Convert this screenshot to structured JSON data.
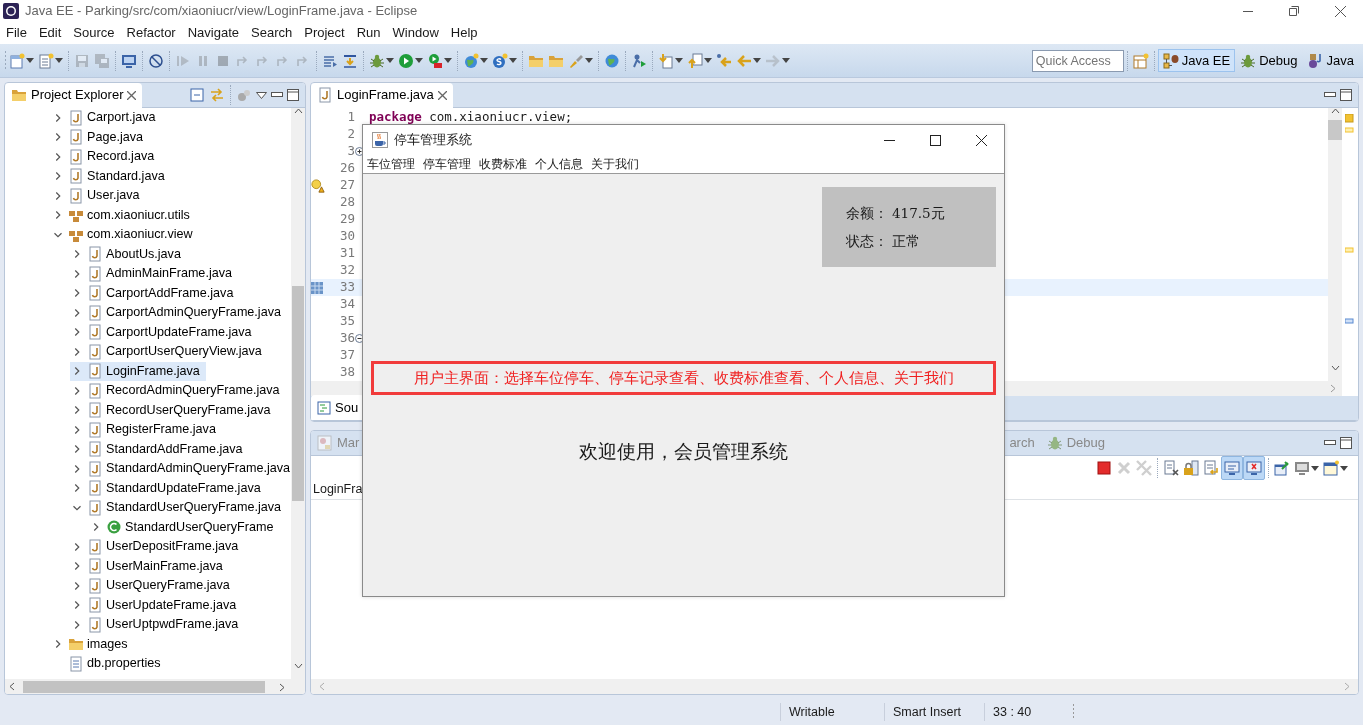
{
  "window": {
    "title": "Java EE - Parking/src/com/xiaoniucr/view/LoginFrame.java - Eclipse"
  },
  "menu": [
    "File",
    "Edit",
    "Source",
    "Refactor",
    "Navigate",
    "Search",
    "Project",
    "Run",
    "Window",
    "Help"
  ],
  "toolbar": [
    {
      "kind": "sheet",
      "dropdown": true,
      "disabled": false
    },
    {
      "kind": "sheet2",
      "dropdown": true,
      "disabled": false
    },
    {
      "kind": "separator"
    },
    {
      "kind": "disk",
      "dropdown": false,
      "disabled": true
    },
    {
      "kind": "disks",
      "dropdown": false,
      "disabled": true
    },
    {
      "kind": "separator"
    },
    {
      "kind": "monitor",
      "dropdown": false,
      "disabled": false
    },
    {
      "kind": "separator"
    },
    {
      "kind": "slash",
      "dropdown": false,
      "disabled": false
    },
    {
      "kind": "separator"
    },
    {
      "kind": "play",
      "dropdown": false,
      "disabled": true
    },
    {
      "kind": "pause",
      "dropdown": false,
      "disabled": true
    },
    {
      "kind": "stop",
      "dropdown": false,
      "disabled": true
    },
    {
      "kind": "step",
      "dropdown": false,
      "disabled": true
    },
    {
      "kind": "step",
      "dropdown": false,
      "disabled": true
    },
    {
      "kind": "step",
      "dropdown": false,
      "disabled": true
    },
    {
      "kind": "step",
      "dropdown": false,
      "disabled": true
    },
    {
      "kind": "separator"
    },
    {
      "kind": "lines",
      "dropdown": false,
      "disabled": false
    },
    {
      "kind": "stepinto",
      "dropdown": false,
      "disabled": false
    },
    {
      "kind": "separator"
    },
    {
      "kind": "bug",
      "dropdown": true,
      "disabled": false
    },
    {
      "kind": "run",
      "dropdown": true,
      "disabled": false
    },
    {
      "kind": "runext",
      "dropdown": true,
      "disabled": false
    },
    {
      "kind": "separator"
    },
    {
      "kind": "globestar",
      "dropdown": true,
      "disabled": false
    },
    {
      "kind": "scircle",
      "dropdown": true,
      "disabled": false
    },
    {
      "kind": "separator"
    },
    {
      "kind": "folder",
      "dropdown": false,
      "disabled": false
    },
    {
      "kind": "folder",
      "dropdown": false,
      "disabled": false
    },
    {
      "kind": "brush",
      "dropdown": true,
      "disabled": false
    },
    {
      "kind": "separator"
    },
    {
      "kind": "globe",
      "dropdown": false,
      "disabled": false
    },
    {
      "kind": "separator"
    },
    {
      "kind": "runner",
      "dropdown": false,
      "disabled": false
    },
    {
      "kind": "separator"
    },
    {
      "kind": "downdoc",
      "dropdown": true,
      "disabled": false
    },
    {
      "kind": "updoc",
      "dropdown": true,
      "disabled": false
    },
    {
      "kind": "backstar",
      "dropdown": false,
      "disabled": false
    },
    {
      "kind": "back",
      "dropdown": true,
      "disabled": false
    },
    {
      "kind": "forward",
      "dropdown": true,
      "disabled": true
    }
  ],
  "quick_access": {
    "placeholder": "Quick Access"
  },
  "perspectives": [
    {
      "label": "Java EE",
      "kind": "javaee",
      "selected": true
    },
    {
      "label": "Debug",
      "kind": "bug",
      "selected": false
    },
    {
      "label": "Java",
      "kind": "java",
      "selected": false
    }
  ],
  "project_explorer": {
    "title": "Project Explorer",
    "tree": [
      {
        "label": "Carport.java",
        "kind": "javafile",
        "expanded": false,
        "selected": false
      },
      {
        "label": "Page.java",
        "kind": "javafile",
        "expanded": false,
        "selected": false
      },
      {
        "label": "Record.java",
        "kind": "javafile",
        "expanded": false,
        "selected": false
      },
      {
        "label": "Standard.java",
        "kind": "javafile",
        "expanded": false,
        "selected": false
      },
      {
        "label": "User.java",
        "kind": "javafile",
        "expanded": false,
        "selected": false
      },
      {
        "label": "com.xiaoniucr.utils",
        "kind": "package",
        "expanded": false,
        "selected": false
      },
      {
        "label": "com.xiaoniucr.view",
        "kind": "package",
        "expanded": true,
        "selected": false,
        "children": [
          {
            "label": "AboutUs.java",
            "kind": "javafile",
            "expanded": false,
            "selected": false
          },
          {
            "label": "AdminMainFrame.java",
            "kind": "javafile",
            "expanded": false,
            "selected": false
          },
          {
            "label": "CarportAddFrame.java",
            "kind": "javafile",
            "expanded": false,
            "selected": false
          },
          {
            "label": "CarportAdminQueryFrame.java",
            "kind": "javafile",
            "expanded": false,
            "selected": false
          },
          {
            "label": "CarportUpdateFrame.java",
            "kind": "javafile",
            "expanded": false,
            "selected": false
          },
          {
            "label": "CarportUserQueryView.java",
            "kind": "javafile",
            "expanded": false,
            "selected": false
          },
          {
            "label": "LoginFrame.java",
            "kind": "javafile",
            "expanded": false,
            "selected": true
          },
          {
            "label": "RecordAdminQueryFrame.java",
            "kind": "javafile",
            "expanded": false,
            "selected": false
          },
          {
            "label": "RecordUserQueryFrame.java",
            "kind": "javafile",
            "expanded": false,
            "selected": false
          },
          {
            "label": "RegisterFrame.java",
            "kind": "javafile",
            "expanded": false,
            "selected": false
          },
          {
            "label": "StandardAddFrame.java",
            "kind": "javafile",
            "expanded": false,
            "selected": false
          },
          {
            "label": "StandardAdminQueryFrame.java",
            "kind": "javafile",
            "expanded": false,
            "selected": false
          },
          {
            "label": "StandardUpdateFrame.java",
            "kind": "javafile",
            "expanded": false,
            "selected": false
          },
          {
            "label": "StandardUserQueryFrame.java",
            "kind": "javafile",
            "expanded": true,
            "selected": false,
            "children": [
              {
                "label": "StandardUserQueryFrame",
                "kind": "class",
                "expanded": false,
                "selected": false
              }
            ]
          },
          {
            "label": "UserDepositFrame.java",
            "kind": "javafile",
            "expanded": false,
            "selected": false
          },
          {
            "label": "UserMainFrame.java",
            "kind": "javafile",
            "expanded": false,
            "selected": false
          },
          {
            "label": "UserQueryFrame.java",
            "kind": "javafile",
            "expanded": false,
            "selected": false
          },
          {
            "label": "UserUpdateFrame.java",
            "kind": "javafile",
            "expanded": false,
            "selected": false
          },
          {
            "label": "UserUptpwdFrame.java",
            "kind": "javafile",
            "expanded": false,
            "selected": false
          }
        ]
      },
      {
        "label": "images",
        "kind": "folder",
        "expanded": false,
        "selected": false
      },
      {
        "label": "db.properties",
        "kind": "properties",
        "selected": false
      }
    ]
  },
  "editor": {
    "tabs": [
      {
        "label": "LoginFrame.java",
        "selected": true
      }
    ],
    "lines": [
      {
        "number": "1",
        "current": false,
        "code": [
          {
            "text": "package",
            "kind": "keyword"
          },
          {
            "text": " com.xiaoniucr.view;",
            "kind": "plain"
          }
        ]
      },
      {
        "number": "2",
        "current": false
      },
      {
        "number": "3",
        "current": false,
        "expanded": false
      },
      {
        "number": "26",
        "current": false
      },
      {
        "number": "27",
        "current": false,
        "warning": true
      },
      {
        "number": "28",
        "current": false
      },
      {
        "number": "29",
        "current": false
      },
      {
        "number": "30",
        "current": false
      },
      {
        "number": "31",
        "current": false
      },
      {
        "number": "32",
        "current": false
      },
      {
        "number": "33",
        "current": true
      },
      {
        "number": "34",
        "current": false
      },
      {
        "number": "35",
        "current": false
      },
      {
        "number": "36",
        "current": false,
        "expanded": true
      },
      {
        "number": "37",
        "current": false
      },
      {
        "number": "38",
        "current": false
      }
    ],
    "bottom_tabs": [
      {
        "label": "Sou",
        "selected": true
      }
    ]
  },
  "bottom_panel": {
    "tabs": [
      {
        "label": "Mar",
        "kind": "markers",
        "selected": false
      },
      {
        "label": "arch",
        "kind": "plain",
        "selected": false
      },
      {
        "label": "Debug",
        "kind": "bug",
        "selected": false
      }
    ],
    "toolbar": [
      {
        "kind": "stopred",
        "dropdown": false,
        "disabled": false,
        "pressed": false
      },
      {
        "kind": "cross",
        "dropdown": false,
        "disabled": true,
        "pressed": false
      },
      {
        "kind": "crosses",
        "dropdown": false,
        "disabled": true,
        "pressed": false
      },
      {
        "kind": "separator"
      },
      {
        "kind": "sheetx",
        "dropdown": false,
        "disabled": false,
        "pressed": false
      },
      {
        "kind": "lock",
        "dropdown": false,
        "disabled": false,
        "pressed": false
      },
      {
        "kind": "sheetarrow",
        "dropdown": false,
        "disabled": false,
        "pressed": false
      },
      {
        "kind": "console",
        "dropdown": false,
        "disabled": false,
        "pressed": true
      },
      {
        "kind": "consolex",
        "dropdown": false,
        "disabled": false,
        "pressed": true
      },
      {
        "kind": "separator"
      },
      {
        "kind": "pin",
        "dropdown": false,
        "disabled": false,
        "pressed": false
      },
      {
        "kind": "monitorgrey",
        "dropdown": true,
        "disabled": false,
        "pressed": false
      },
      {
        "kind": "window",
        "dropdown": true,
        "disabled": false,
        "pressed": false
      }
    ],
    "console_title": "LoginFra"
  },
  "app_window": {
    "title": "停车管理系统",
    "menu": [
      "车位管理",
      "停车管理",
      "收费标准",
      "个人信息",
      "关于我们"
    ],
    "account": [
      {
        "label": "余额：",
        "value": "417.5元"
      },
      {
        "label": "状态：",
        "value": "正常"
      }
    ],
    "caption": "用户主界面：选择车位停车、停车记录查看、收费标准查看、个人信息、关于我们",
    "welcome": "欢迎使用，会员管理系统"
  },
  "status_bar": [
    "Writable",
    "Smart Insert",
    "33 : 40"
  ]
}
